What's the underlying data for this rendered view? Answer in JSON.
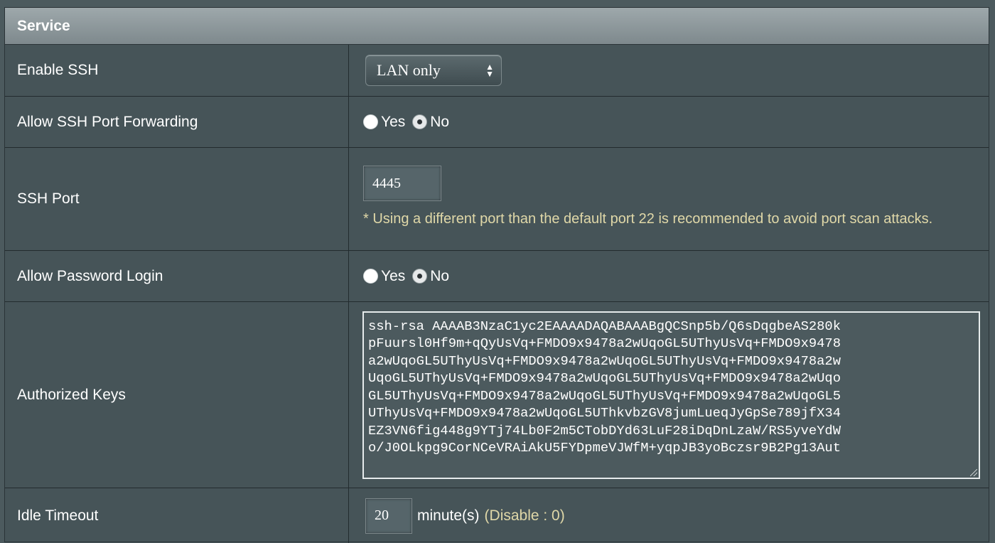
{
  "section": {
    "title": "Service"
  },
  "rows": {
    "enable_ssh": {
      "label": "Enable SSH",
      "selected": "LAN only"
    },
    "port_forwarding": {
      "label": "Allow SSH Port Forwarding",
      "yes": "Yes",
      "no": "No",
      "selected": "No"
    },
    "ssh_port": {
      "label": "SSH Port",
      "value": "4445",
      "hint": "* Using a different port than the default port 22 is recommended to avoid port scan attacks."
    },
    "password_login": {
      "label": "Allow Password Login",
      "yes": "Yes",
      "no": "No",
      "selected": "No"
    },
    "authorized_keys": {
      "label": "Authorized Keys",
      "lines": [
        "ssh-rsa AAAAB3NzaC1yc2EAAAADAQABAAABgQCSnp5b/Q6sDqgbeAS280k",
        "pFuursl0Hf9m+qQyUsVq+FMDO9x9478a2wUqoGL5UThyUsVq+FMDO9x9478",
        "a2wUqoGL5UThyUsVq+FMDO9x9478a2wUqoGL5UThyUsVq+FMDO9x9478a2w",
        "UqoGL5UThyUsVq+FMDO9x9478a2wUqoGL5UThyUsVq+FMDO9x9478a2wUqo",
        "GL5UThyUsVq+FMDO9x9478a2wUqoGL5UThyUsVq+FMDO9x9478a2wUqoGL5",
        "UThyUsVq+FMDO9x9478a2wUqoGL5UThkvbzGV8jumLueqJyGpSe789jfX34",
        "EZ3VN6fig448g9YTj74Lb0F2m5CTobDYd63LuF28iDqDnLzaW/RS5yveYdW",
        "o/J0OLkpg9CorNCeVRAiAkU5FYDpmeVJWfM+yqpJB3yoBczsr9B2Pg13Aut"
      ]
    },
    "idle_timeout": {
      "label": "Idle Timeout",
      "value": "20",
      "unit": "minute(s)",
      "hint": "(Disable : 0)"
    }
  }
}
